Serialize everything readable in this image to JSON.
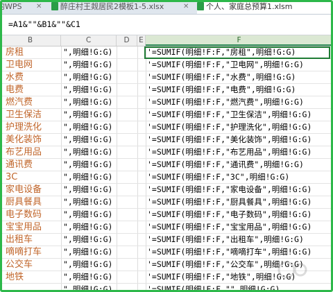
{
  "tabs": [
    {
      "label": "的WPS",
      "icon_color": "#1f6fd1"
    },
    {
      "label": "醉庄村王觌居民2模板1-5.xlsx",
      "icon_color": "#2a9d46"
    },
    {
      "label": "个人、家庭总预算1.xlsm",
      "icon_color": "#2a9d46"
    }
  ],
  "formula": "=A1&\"\"&B1&\"\"&C1",
  "columns": [
    "B",
    "C",
    "D",
    "E",
    "F"
  ],
  "rows": [
    {
      "b": "房租",
      "c": "\",明细!G:G)",
      "f": "'=SUMIF(明细!F:F,\"房租\",明细!G:G)"
    },
    {
      "b": "卫电网",
      "c": "\",明细!G:G)",
      "f": "'=SUMIF(明细!F:F,\"卫电网\",明细!G:G)"
    },
    {
      "b": "水费",
      "c": "\",明细!G:G)",
      "f": "'=SUMIF(明细!F:F,\"水费\",明细!G:G)"
    },
    {
      "b": "电费",
      "c": "\",明细!G:G)",
      "f": "'=SUMIF(明细!F:F,\"电费\",明细!G:G)"
    },
    {
      "b": "燃汽费",
      "c": "\",明细!G:G)",
      "f": "'=SUMIF(明细!F:F,\"燃汽费\",明细!G:G)"
    },
    {
      "b": "卫生保洁",
      "c": "\",明细!G:G)",
      "f": "'=SUMIF(明细!F:F,\"卫生保洁\",明细!G:G)"
    },
    {
      "b": "护理洗化",
      "c": "\",明细!G:G)",
      "f": "'=SUMIF(明细!F:F,\"护理洗化\",明细!G:G)"
    },
    {
      "b": "美化装饰",
      "c": "\",明细!G:G)",
      "f": "'=SUMIF(明细!F:F,\"美化装饰\",明细!G:G)"
    },
    {
      "b": "布艺用品",
      "c": "\",明细!G:G)",
      "f": "'=SUMIF(明细!F:F,\"布艺用品\",明细!G:G)"
    },
    {
      "b": "通讯费",
      "c": "\",明细!G:G)",
      "f": "'=SUMIF(明细!F:F,\"通讯费\",明细!G:G)"
    },
    {
      "b": "3C",
      "c": "\",明细!G:G)",
      "f": "'=SUMIF(明细!F:F,\"3C\",明细!G:G)"
    },
    {
      "b": "家电设备",
      "c": "\",明细!G:G)",
      "f": "'=SUMIF(明细!F:F,\"家电设备\",明细!G:G)"
    },
    {
      "b": "厨具餐具",
      "c": "\",明细!G:G)",
      "f": "'=SUMIF(明细!F:F,\"厨具餐具\",明细!G:G)"
    },
    {
      "b": "电子数码",
      "c": "\",明细!G:G)",
      "f": "'=SUMIF(明细!F:F,\"电子数码\",明细!G:G)"
    },
    {
      "b": "宝宝用品",
      "c": "\",明细!G:G)",
      "f": "'=SUMIF(明细!F:F,\"宝宝用品\",明细!G:G)"
    },
    {
      "b": "出租车",
      "c": "\",明细!G:G)",
      "f": "'=SUMIF(明细!F:F,\"出租车\",明细!G:G)"
    },
    {
      "b": "嘀嘀打车",
      "c": "\",明细!G:G)",
      "f": "'=SUMIF(明细!F:F,\"嘀嘀打车\",明细!G:G)"
    },
    {
      "b": "公交车",
      "c": "\",明细!G:G)",
      "f": "'=SUMIF(明细!F:F,\"公交车\",明细!G:G)"
    },
    {
      "b": "地铁",
      "c": "\",明细!G:G)",
      "f": "'=SUMIF(明细!F:F,\"地铁\",明细!G:G)"
    },
    {
      "b": "",
      "c": "\",明细!G:G)",
      "f": "'=SUMIF(明细!F:F,\"\",明细!G:G)"
    }
  ]
}
